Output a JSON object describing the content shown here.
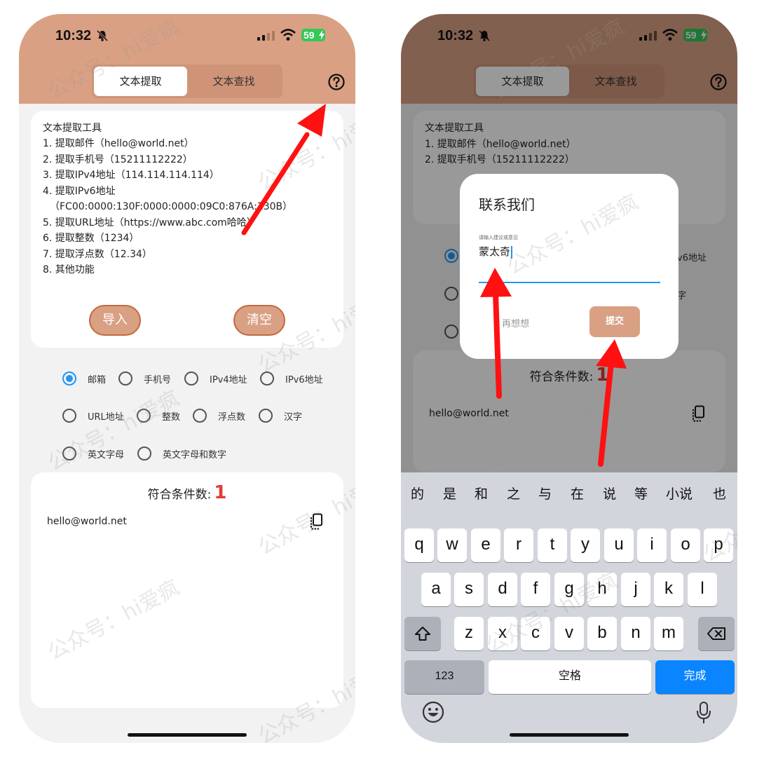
{
  "status": {
    "time": "10:32",
    "battery": "59"
  },
  "tabs": [
    {
      "label": "文本提取"
    },
    {
      "label": "文本查找"
    }
  ],
  "description": {
    "title": "文本提取工具",
    "lines": [
      "1. 提取邮件（hello@world.net）",
      "2. 提取手机号（15211112222）",
      "3. 提取IPv4地址（114.114.114.114）",
      "4. 提取IPv6地址",
      "（FC00:0000:130F:0000:0000:09C0:876A:130B）",
      "5. 提取URL地址（https://www.abc.com哈哈）",
      "6. 提取整数（1234）",
      "7. 提取浮点数（12.34）",
      "8. 其他功能"
    ]
  },
  "buttons": {
    "import": "导入",
    "clear": "清空"
  },
  "radios": [
    {
      "label": "邮箱",
      "checked": true
    },
    {
      "label": "手机号"
    },
    {
      "label": "IPv4地址"
    },
    {
      "label": "IPv6地址"
    },
    {
      "label": "URL地址"
    },
    {
      "label": "整数"
    },
    {
      "label": "浮点数"
    },
    {
      "label": "汉字"
    },
    {
      "label": "英文字母"
    },
    {
      "label": "英文字母和数字"
    }
  ],
  "result": {
    "label": "符合条件数:",
    "count": "1",
    "items": [
      "hello@world.net"
    ]
  },
  "dialog": {
    "title": "联系我们",
    "hint": "请输入建议或意见",
    "value": "蒙太奇",
    "cancel": "再想想",
    "submit": "提交"
  },
  "right_visible": {
    "desc_lines": [
      "文本提取工具",
      "1. 提取邮件（hello@world.net）",
      "2. 提取手机号（15211112222）"
    ],
    "ipv6_partial": "v6地址",
    "hanzi_partial": "字"
  },
  "keyboard": {
    "candidates": [
      "的",
      "是",
      "和",
      "之",
      "与",
      "在",
      "说",
      "等",
      "小说",
      "也"
    ],
    "row1": [
      "q",
      "w",
      "e",
      "r",
      "t",
      "y",
      "u",
      "i",
      "o",
      "p"
    ],
    "row2": [
      "a",
      "s",
      "d",
      "f",
      "g",
      "h",
      "j",
      "k",
      "l"
    ],
    "row3": [
      "z",
      "x",
      "c",
      "v",
      "b",
      "n",
      "m"
    ],
    "numbers": "123",
    "space": "空格",
    "done": "完成"
  },
  "watermark": "公众号：hi爱疯",
  "colors": {
    "header": "#d9a084",
    "accent": "#2196f3",
    "count": "#e53935",
    "arrow": "#ff1111",
    "done": "#0a84ff"
  }
}
